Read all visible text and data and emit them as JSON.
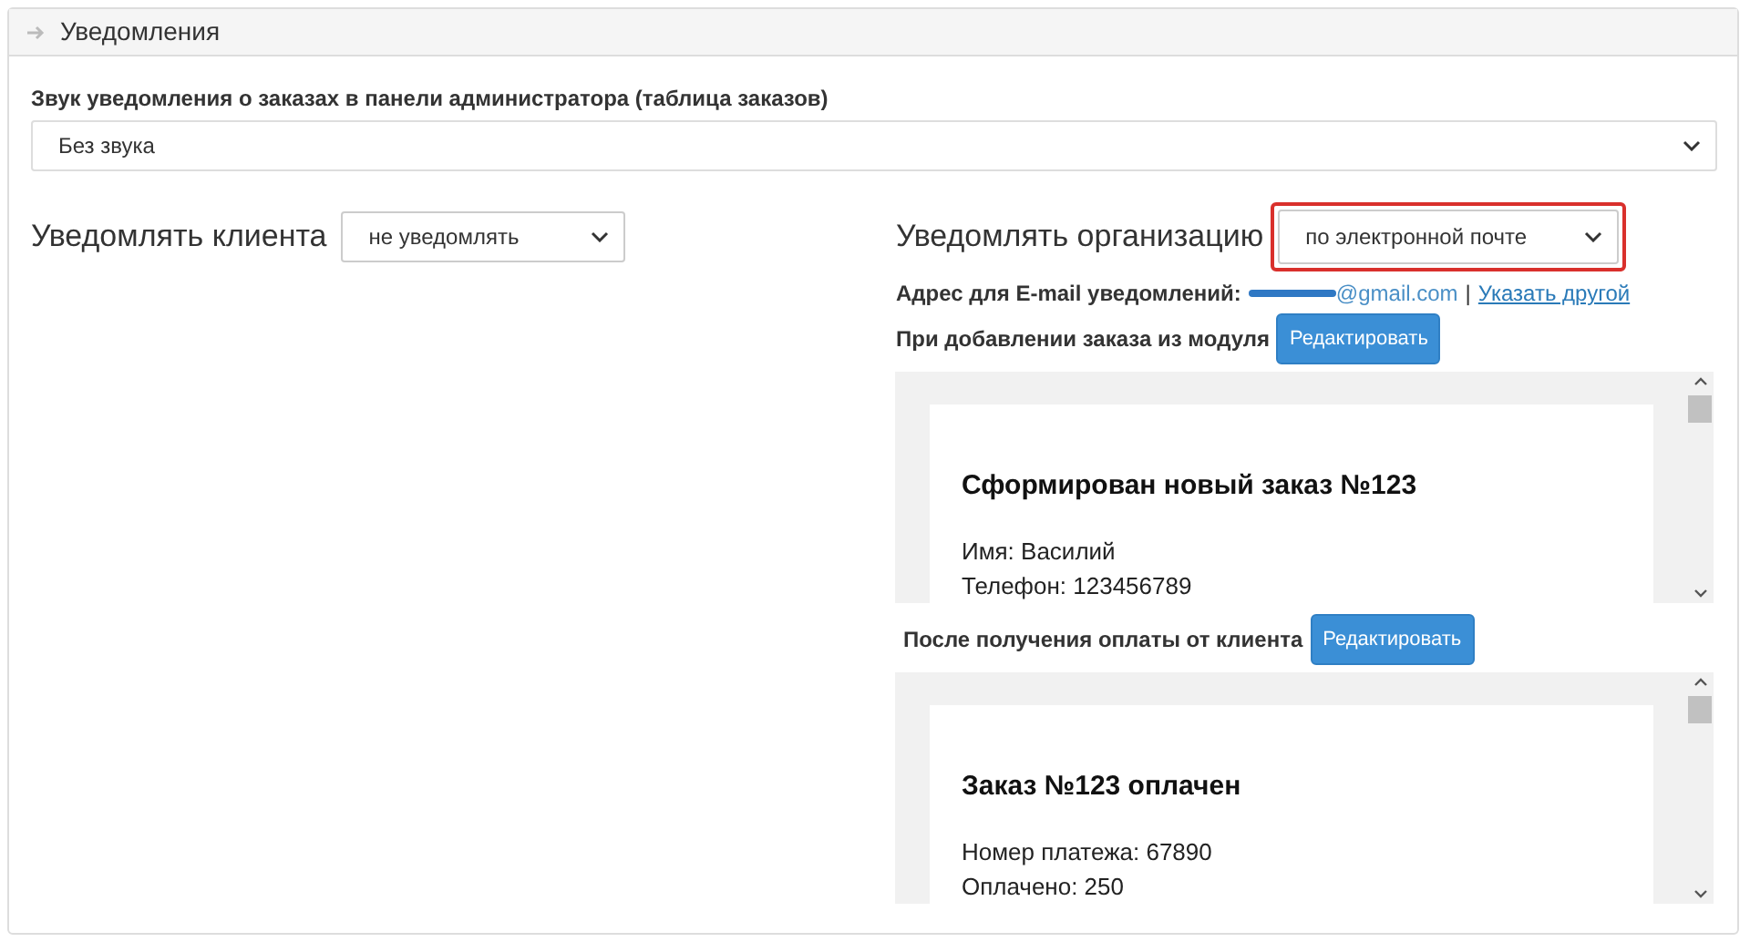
{
  "section": {
    "title": "Уведомления"
  },
  "sound": {
    "label": "Звук уведомления о заказах в панели администратора (таблица заказов)",
    "value": "Без звука"
  },
  "client": {
    "label": "Уведомлять клиента",
    "value": "не уведомлять"
  },
  "organization": {
    "label": "Уведомлять организацию",
    "value": "по электронной почте",
    "highlighted": true
  },
  "email": {
    "label": "Адрес для E-mail уведомлений:",
    "value": "@gmail.com",
    "separator": "|",
    "link": "Указать другой"
  },
  "templates": [
    {
      "label": "При добавлении заказа из модуля",
      "button": "Редактировать",
      "preview": {
        "heading": "Сформирован новый заказ №123",
        "lines": [
          "Имя: Василий",
          "Телефон: 123456789"
        ]
      }
    },
    {
      "label": "После получения оплаты от клиента",
      "button": "Редактировать",
      "preview": {
        "heading": "Заказ №123 оплачен",
        "lines": [
          "Номер платежа: 67890",
          "Оплачено: 250"
        ]
      }
    }
  ]
}
